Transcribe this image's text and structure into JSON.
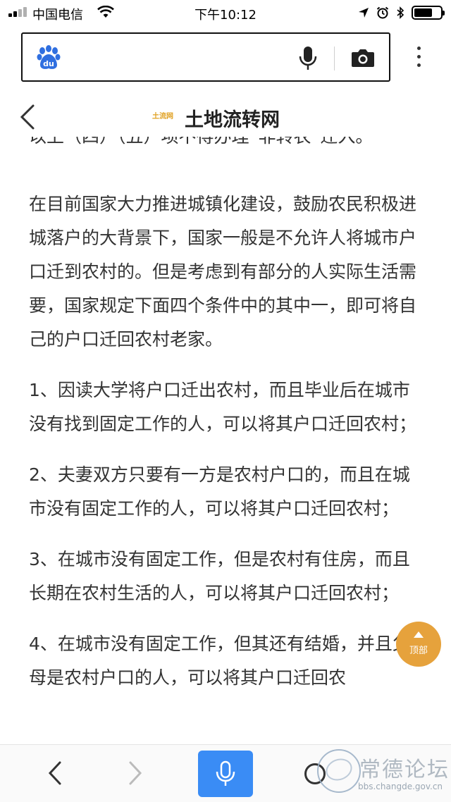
{
  "status_bar": {
    "carrier": "中国电信",
    "time": "下午10:12",
    "battery_level": 0.7,
    "icons": [
      "signal-icon",
      "wifi-icon",
      "location-arrow-icon",
      "alarm-icon",
      "bluetooth-icon",
      "battery-icon"
    ]
  },
  "search_bar": {
    "logo_text": "du",
    "icons": [
      "baidu-paw-icon",
      "microphone-icon",
      "camera-icon",
      "more-vertical-icon"
    ]
  },
  "site_header": {
    "logo_text": "土流网",
    "title": "土地流转网"
  },
  "article": {
    "paragraphs": [
      "以上（四）（五）项不得办理“非转农”迁入。",
      "在目前国家大力推进城镇化建设，鼓励农民积极进城落户的大背景下，国家一般是不允许人将城市户口迁到农村的。但是考虑到有部分的人实际生活需要，国家规定下面四个条件中的其中一，即可将自己的户口迁回农村老家。",
      "1、因读大学将户口迁出农村，而且毕业后在城市没有找到固定工作的人，可以将其户口迁回农村；",
      "2、夫妻双方只要有一方是农村户口的，而且在城市没有固定工作的人，可以将其户口迁回农村；",
      "3、在城市没有固定工作，但是农村有住房，而且长期在农村生活的人，可以将其户口迁回农村；",
      "4、在城市没有固定工作，但其还有结婚，并且父母是农村户口的人，可以将其户口迁回农"
    ]
  },
  "back_to_top": {
    "label": "顶部",
    "color": "#e6a23c"
  },
  "bottom_bar": {
    "voice_button_color": "#3a8cf5",
    "watermark_name": "常德论坛",
    "watermark_url": "bbs.changde.gov.cn"
  }
}
